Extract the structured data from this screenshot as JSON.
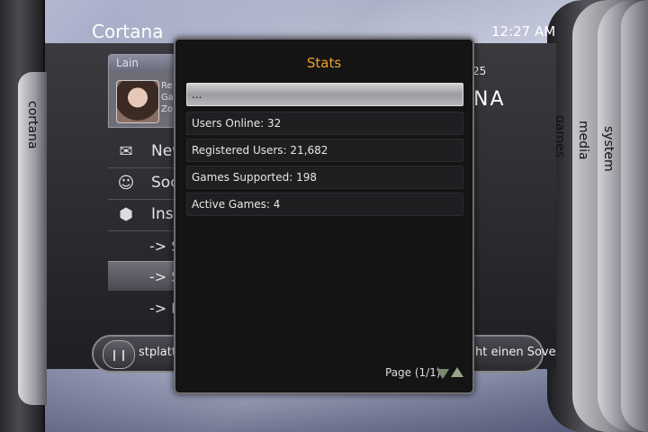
{
  "header": {
    "title": "Cortana",
    "clock": "12:27 AM"
  },
  "profile": {
    "name": "Lain",
    "line1": "Re",
    "line2": "Ga",
    "line3": "Zo"
  },
  "left_blade_label": "cortana",
  "right_blades": [
    "games",
    "media",
    "system"
  ],
  "right_panel": {
    "number": "25",
    "logo": "NA"
  },
  "menu": {
    "items": [
      {
        "label": "New",
        "icon": "mail-icon"
      },
      {
        "label": "Soc",
        "icon": "user-icon"
      },
      {
        "label": "Insi",
        "icon": "cube-icon"
      }
    ],
    "subitems": [
      "-> S",
      "-> S",
      "-> E"
    ]
  },
  "bottom_bar": {
    "button_icon": "pause-icon",
    "left_text": "stplatte",
    "right_text": "ht einen Sove"
  },
  "dialog": {
    "title": "Stats",
    "rows": [
      "...",
      "Users Online: 32",
      "Registered Users: 21,682",
      "Games Supported: 198",
      "Active Games: 4"
    ],
    "pager": "Page (1/1)"
  }
}
